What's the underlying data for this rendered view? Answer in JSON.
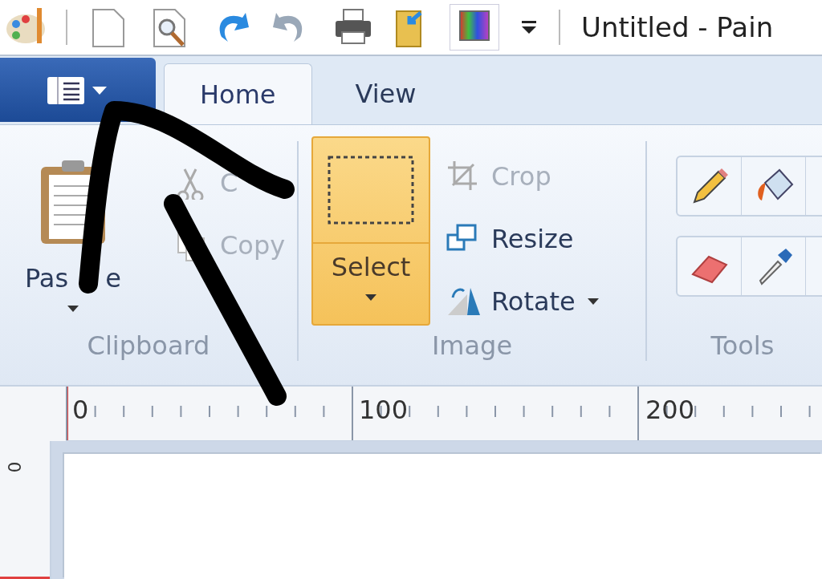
{
  "window": {
    "title": "Untitled - Pain"
  },
  "tabs": [
    {
      "label": "Home",
      "selected": true
    },
    {
      "label": "View",
      "selected": false
    }
  ],
  "ribbon": {
    "groups": [
      {
        "label": "Clipboard",
        "large": {
          "label": "Pas e",
          "selected": false,
          "dropdown": true
        },
        "small": [
          {
            "label": "C",
            "disabled": true,
            "dropdown": false
          },
          {
            "label": "Copy",
            "disabled": true,
            "dropdown": false
          }
        ]
      },
      {
        "label": "Image",
        "large": {
          "label": "Select",
          "selected": true,
          "dropdown": true
        },
        "small": [
          {
            "label": "Crop",
            "disabled": true,
            "dropdown": false
          },
          {
            "label": "Resize",
            "disabled": false,
            "dropdown": false
          },
          {
            "label": "Rotate",
            "disabled": false,
            "dropdown": true
          }
        ]
      },
      {
        "label": "Tools"
      }
    ]
  },
  "ruler": {
    "labels": [
      "0",
      "100",
      "200"
    ],
    "vertical_labels": [
      "0"
    ]
  }
}
